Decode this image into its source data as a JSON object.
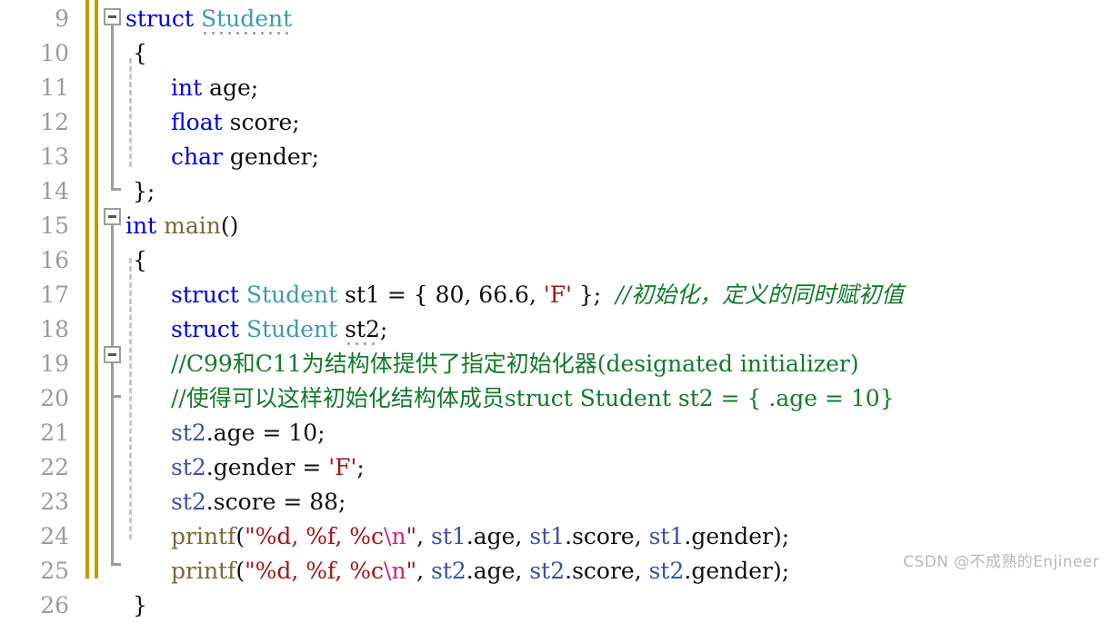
{
  "editor": {
    "first_line": 9,
    "line_height": 38,
    "language": "C",
    "gutter_line_numbers": [
      "9",
      "10",
      "11",
      "12",
      "13",
      "14",
      "15",
      "16",
      "17",
      "18",
      "19",
      "20",
      "21",
      "22",
      "23",
      "24",
      "25",
      "26"
    ],
    "change_bar_color": "#bf9d00",
    "fold_marker_color": "#9c9c9c",
    "indent_guide_color": "#c9c9c9",
    "colors": {
      "background": "#ffffff",
      "foreground": "#101010",
      "line_number": "#9b9b9b",
      "keyword": "#0000e8",
      "user_type": "#3d9aaf",
      "function": "#7a6a3a",
      "string": "#a31515",
      "escape": "#c12a8a",
      "identifier": "#3c4fa8",
      "comment": "#137a2e"
    }
  },
  "lines": [
    {
      "number": "9",
      "fold": "open",
      "tokens": [
        {
          "t": "struct",
          "c": "kw"
        },
        {
          "t": " ",
          "c": "punc"
        },
        {
          "t": "Student",
          "c": "type",
          "underline": "dots"
        }
      ]
    },
    {
      "number": "10",
      "tokens": [
        {
          "t": "{",
          "c": "punc"
        }
      ]
    },
    {
      "number": "11",
      "tokens": [
        {
          "t": "int",
          "c": "kw"
        },
        {
          "t": " age;",
          "c": "punc"
        }
      ]
    },
    {
      "number": "12",
      "tokens": [
        {
          "t": "float",
          "c": "kw"
        },
        {
          "t": " score;",
          "c": "punc"
        }
      ]
    },
    {
      "number": "13",
      "tokens": [
        {
          "t": "char",
          "c": "kw"
        },
        {
          "t": " gender;",
          "c": "punc"
        }
      ]
    },
    {
      "number": "14",
      "tokens": [
        {
          "t": "};",
          "c": "punc"
        }
      ]
    },
    {
      "number": "15",
      "fold": "open",
      "tokens": [
        {
          "t": "int",
          "c": "kw"
        },
        {
          "t": " ",
          "c": "punc"
        },
        {
          "t": "main",
          "c": "fn"
        },
        {
          "t": "()",
          "c": "punc"
        }
      ]
    },
    {
      "number": "16",
      "tokens": [
        {
          "t": "{",
          "c": "punc"
        }
      ]
    },
    {
      "number": "17",
      "tokens": [
        {
          "t": "struct",
          "c": "kw"
        },
        {
          "t": " ",
          "c": "punc"
        },
        {
          "t": "Student",
          "c": "type"
        },
        {
          "t": " st1 = { 80, 66.6, ",
          "c": "punc"
        },
        {
          "t": "'F'",
          "c": "str"
        },
        {
          "t": " };  ",
          "c": "punc"
        },
        {
          "t": "//初始化，定义的同时赋初值",
          "c": "cmt"
        }
      ]
    },
    {
      "number": "18",
      "tokens": [
        {
          "t": "struct",
          "c": "kw"
        },
        {
          "t": " ",
          "c": "punc"
        },
        {
          "t": "Student",
          "c": "type"
        },
        {
          "t": " ",
          "c": "punc"
        },
        {
          "t": "st2",
          "c": "punc",
          "underline": "dots"
        },
        {
          "t": ";",
          "c": "punc"
        }
      ]
    },
    {
      "number": "19",
      "fold": "open",
      "tokens": [
        {
          "t": "//C99和C11为结构体提供了指定初始化器(designated initializer)",
          "c": "cmt-up"
        }
      ]
    },
    {
      "number": "20",
      "tokens": [
        {
          "t": "//使得可以这样初始化结构体成员struct Student st2 = { .age = 10}",
          "c": "cmt-up"
        }
      ]
    },
    {
      "number": "21",
      "tokens": [
        {
          "t": "st2",
          "c": "var"
        },
        {
          "t": ".age = 10;",
          "c": "punc"
        }
      ]
    },
    {
      "number": "22",
      "tokens": [
        {
          "t": "st2",
          "c": "var"
        },
        {
          "t": ".gender = ",
          "c": "punc"
        },
        {
          "t": "'F'",
          "c": "str"
        },
        {
          "t": ";",
          "c": "punc"
        }
      ]
    },
    {
      "number": "23",
      "tokens": [
        {
          "t": "st2",
          "c": "var"
        },
        {
          "t": ".score = 88;",
          "c": "punc"
        }
      ]
    },
    {
      "number": "24",
      "tokens": [
        {
          "t": "printf",
          "c": "fn"
        },
        {
          "t": "(",
          "c": "punc"
        },
        {
          "t": "\"%d, %f, %c",
          "c": "str"
        },
        {
          "t": "\\n",
          "c": "esc"
        },
        {
          "t": "\"",
          "c": "str"
        },
        {
          "t": ", ",
          "c": "punc"
        },
        {
          "t": "st1",
          "c": "var"
        },
        {
          "t": ".age, ",
          "c": "punc"
        },
        {
          "t": "st1",
          "c": "var"
        },
        {
          "t": ".score, ",
          "c": "punc"
        },
        {
          "t": "st1",
          "c": "var"
        },
        {
          "t": ".gender);",
          "c": "punc"
        }
      ]
    },
    {
      "number": "25",
      "tokens": [
        {
          "t": "printf",
          "c": "fn"
        },
        {
          "t": "(",
          "c": "punc"
        },
        {
          "t": "\"%d, %f, %c",
          "c": "str"
        },
        {
          "t": "\\n",
          "c": "esc"
        },
        {
          "t": "\"",
          "c": "str"
        },
        {
          "t": ", ",
          "c": "punc"
        },
        {
          "t": "st2",
          "c": "var"
        },
        {
          "t": ".age, ",
          "c": "punc"
        },
        {
          "t": "st2",
          "c": "var"
        },
        {
          "t": ".score, ",
          "c": "punc"
        },
        {
          "t": "st2",
          "c": "var"
        },
        {
          "t": ".gender);",
          "c": "punc"
        }
      ]
    },
    {
      "number": "26",
      "tokens": [
        {
          "t": "}",
          "c": "punc"
        }
      ]
    }
  ],
  "watermark": {
    "text": "CSDN @不成熟的Enjineer"
  }
}
